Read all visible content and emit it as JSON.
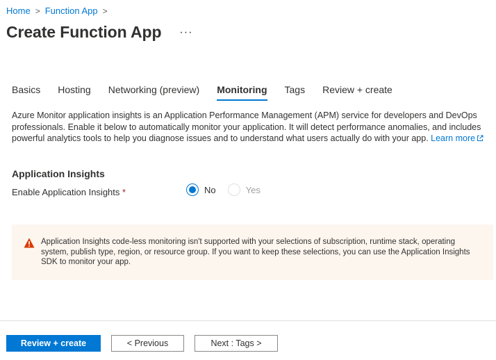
{
  "breadcrumb": {
    "home": "Home",
    "function_app": "Function App",
    "sep": ">"
  },
  "page": {
    "title": "Create Function App",
    "more": "···"
  },
  "tabs": [
    {
      "label": "Basics",
      "active": false
    },
    {
      "label": "Hosting",
      "active": false
    },
    {
      "label": "Networking (preview)",
      "active": false
    },
    {
      "label": "Monitoring",
      "active": true
    },
    {
      "label": "Tags",
      "active": false
    },
    {
      "label": "Review + create",
      "active": false
    }
  ],
  "description": {
    "text": "Azure Monitor application insights is an Application Performance Management (APM) service for developers and DevOps professionals. Enable it below to automatically monitor your application. It will detect performance anomalies, and includes powerful analytics tools to help you diagnose issues and to understand what users actually do with your app.",
    "link": "Learn more",
    "link_icon": "external-link-icon"
  },
  "section": {
    "heading": "Application Insights"
  },
  "field": {
    "label": "Enable Application Insights",
    "required_mark": "*",
    "options": [
      {
        "label": "No",
        "checked": true,
        "disabled": false
      },
      {
        "label": "Yes",
        "checked": false,
        "disabled": true
      }
    ]
  },
  "warning": {
    "icon": "warning-icon",
    "text": "Application Insights code-less monitoring isn't supported with your selections of subscription, runtime stack, operating system, publish type, region, or resource group. If you want to keep these selections, you can use the Application Insights SDK to monitor your app."
  },
  "footer": {
    "review_create": "Review + create",
    "previous": "< Previous",
    "next": "Next : Tags >"
  },
  "colors": {
    "accent": "#0078d4",
    "warning_bg": "#fdf6ef",
    "warning_icon": "#d83b01",
    "required": "#a4262c"
  }
}
